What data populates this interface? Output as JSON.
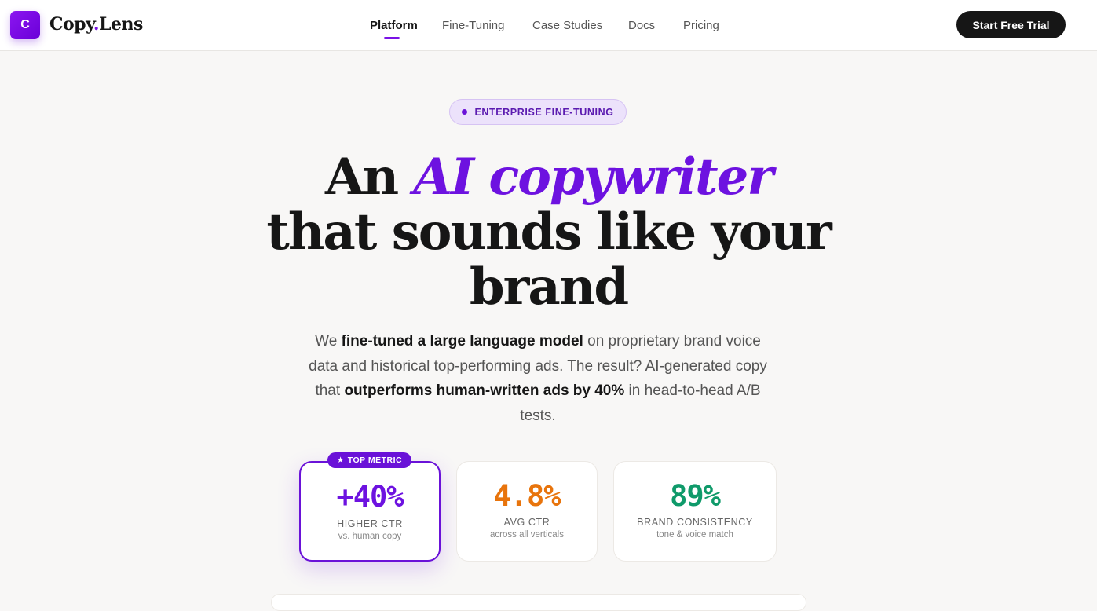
{
  "brand": {
    "logo_letter": "C",
    "name_part1": "Copy",
    "dot": ".",
    "name_part2": "Lens"
  },
  "nav": {
    "links": [
      "Platform",
      "Fine-Tuning",
      "Case Studies",
      "Docs",
      "Pricing"
    ],
    "active": "Platform",
    "cta": "Start Free Trial"
  },
  "hero": {
    "pill": "ENTERPRISE FINE-TUNING",
    "headline_line1_plain": "An",
    "headline_line1_accent": "AI copywriter",
    "headline_line2": "that sounds like your",
    "headline_line3": "brand",
    "sub_1": "We ",
    "sub_bold_1": "fine-tuned a large language model",
    "sub_2": " on proprietary brand voice data and historical top-performing ads. The result? AI-generated copy that ",
    "sub_bold_2": "outperforms human-written ads by 40%",
    "sub_3": " in head-to-head A/B tests."
  },
  "stats": {
    "top_tag": "TOP METRIC",
    "items": [
      {
        "value": "+40%",
        "label": "HIGHER CTR",
        "sub": "vs. human copy",
        "color": "#6d12e0"
      },
      {
        "value": "4.8%",
        "label": "AVG CTR",
        "sub": "across all verticals",
        "color": "#e8740c"
      },
      {
        "value": "89%",
        "label": "BRAND CONSISTENCY",
        "sub": "tone & voice match",
        "color": "#0f9a6a"
      }
    ]
  },
  "colors": {
    "accent": "#6d12e0",
    "dark": "#161616",
    "background": "#f8f7f6"
  }
}
